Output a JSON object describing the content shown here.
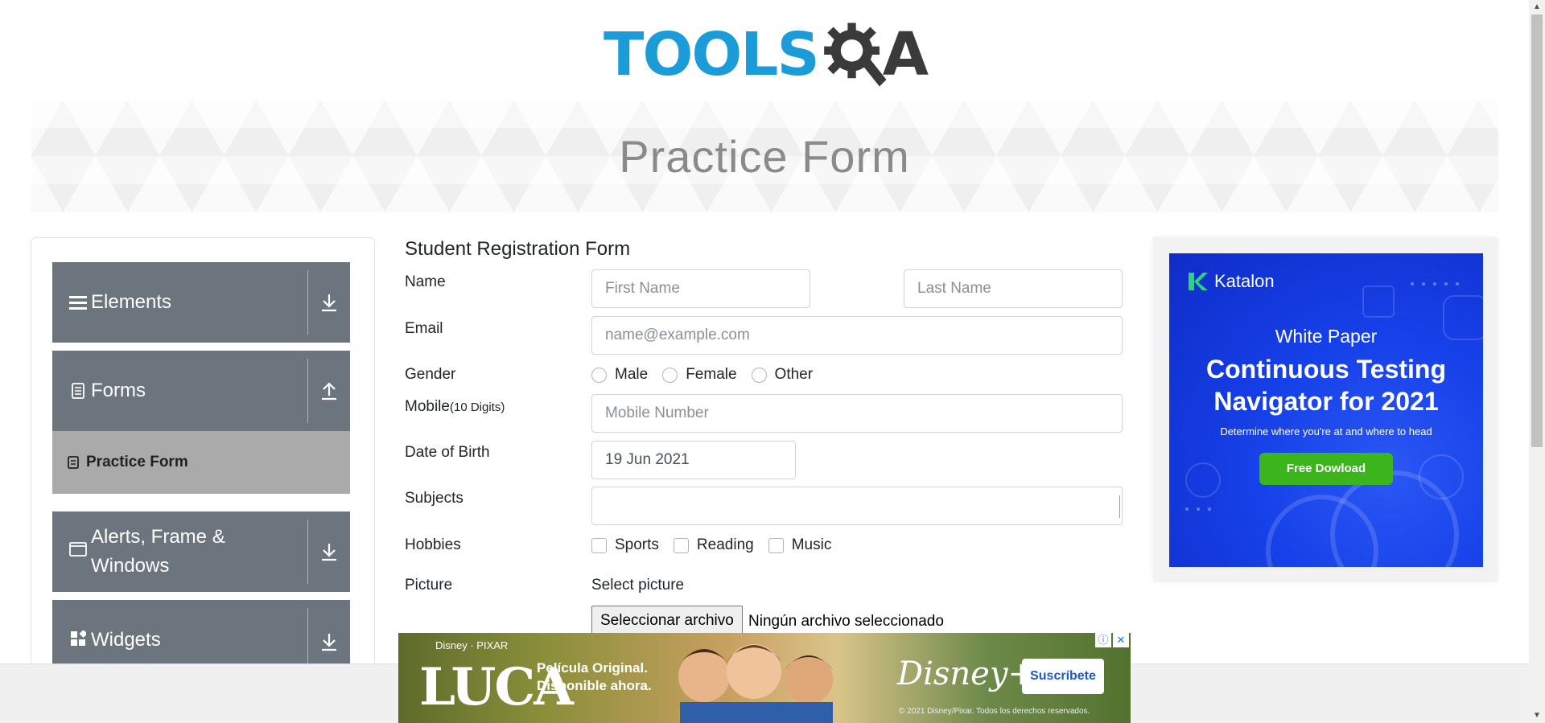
{
  "header": {
    "logo_text_primary": "TOOLS",
    "logo_text_secondary": "A",
    "banner_title": "Practice Form"
  },
  "sidebar": {
    "groups": [
      {
        "label": "Elements",
        "icon": "hamburger-icon",
        "arrow": "download-arrow-icon"
      },
      {
        "label": "Forms",
        "icon": "document-icon",
        "arrow": "upload-arrow-icon"
      },
      {
        "label": "Alerts, Frame & Windows",
        "icon": "window-icon",
        "arrow": "download-arrow-icon"
      },
      {
        "label": "Widgets",
        "icon": "widgets-icon",
        "arrow": "download-arrow-icon"
      }
    ],
    "active_item": {
      "label": "Practice Form",
      "icon": "form-icon"
    }
  },
  "form": {
    "title": "Student Registration Form",
    "name_label": "Name",
    "first_name_placeholder": "First Name",
    "last_name_placeholder": "Last Name",
    "email_label": "Email",
    "email_placeholder": "name@example.com",
    "gender_label": "Gender",
    "gender_options": [
      "Male",
      "Female",
      "Other"
    ],
    "mobile_label": "Mobile",
    "mobile_hint": "(10 Digits)",
    "mobile_placeholder": "Mobile Number",
    "dob_label": "Date of Birth",
    "dob_value": "19 Jun 2021",
    "subjects_label": "Subjects",
    "hobbies_label": "Hobbies",
    "hobby_options": [
      "Sports",
      "Reading",
      "Music"
    ],
    "picture_label": "Picture",
    "picture_select_label": "Select picture",
    "file_button": "Seleccionar archivo",
    "file_status": "Ningún archivo seleccionado"
  },
  "right_ad": {
    "brand": "Katalon",
    "kicker": "White Paper",
    "headline_line1": "Continuous Testing",
    "headline_line2": "Navigator for 2021",
    "tagline": "Determine where you're at and where to head",
    "cta": "Free Dowload",
    "accent_color": "#1640e8",
    "cta_color": "#3cb41c"
  },
  "bottom_ad": {
    "studio": "Disney · PIXAR",
    "title": "LUCA",
    "promo_line1": "Película Original.",
    "promo_line2": "Disponible ahora.",
    "platform": "Disney+",
    "cta": "Suscríbete",
    "copyright": "© 2021 Disney/Pixar. Todos los derechos reservados.",
    "info_icon": "ⓘ",
    "close_icon": "✕"
  }
}
